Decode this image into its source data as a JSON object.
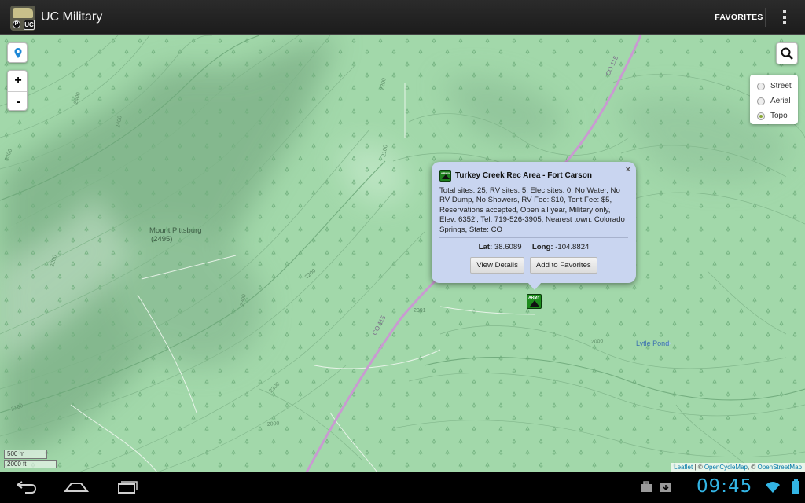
{
  "app": {
    "title": "UC Military",
    "icon_name": "uc-military-app-icon",
    "icon_badge": "UC",
    "icon_small": "P"
  },
  "action_bar": {
    "favorites_label": "FAVORITES",
    "overflow_icon": "overflow-menu-icon"
  },
  "map": {
    "zoom_in_label": "+",
    "zoom_out_label": "-",
    "layers": [
      {
        "label": "Street",
        "selected": false
      },
      {
        "label": "Aerial",
        "selected": false
      },
      {
        "label": "Topo",
        "selected": true
      }
    ],
    "labels": {
      "mount": "Mount Pittsburg",
      "mount_elev": "(2495)",
      "lake": "Lytle Pond",
      "road1": "CO 115",
      "road2": "CO 115"
    },
    "contour_labels": [
      "2400",
      "2400",
      "2300",
      "2200",
      "2100",
      "2200",
      "2300",
      "2300",
      "2200",
      "2100",
      "2000",
      "2000",
      "2001"
    ],
    "scale_metric": "500 m",
    "scale_imperial": "2000 ft",
    "attribution": {
      "leaflet": "Leaflet",
      "sep": " | © ",
      "ocm": "OpenCycleMap",
      "sep2": ", © ",
      "osm": "OpenStreetMap"
    },
    "marker_badge": "ARMY"
  },
  "popup": {
    "title": "Turkey Creek Rec Area - Fort Carson",
    "icon_badge": "ARMY",
    "description": "Total sites: 25, RV sites: 5, Elec sites: 0, No Water, No RV Dump, No Showers, RV Fee: $10, Tent Fee: $5, Reservations accepted, Open all year, Military only, Elev: 6352', Tel: 719-526-3905, Nearest town: Colorado Springs, State: CO",
    "lat_label": "Lat:",
    "lat_value": "38.6089",
    "long_label": "Long:",
    "long_value": "-104.8824",
    "view_details_label": "View Details",
    "add_favorites_label": "Add to Favorites",
    "close_label": "×"
  },
  "system": {
    "clock": "09:45"
  },
  "colors": {
    "map_green": "#9dd5a6",
    "road": "#d0a0d8",
    "accent_blue": "#33b5e5",
    "popup_bg": "#c9d5f0"
  }
}
